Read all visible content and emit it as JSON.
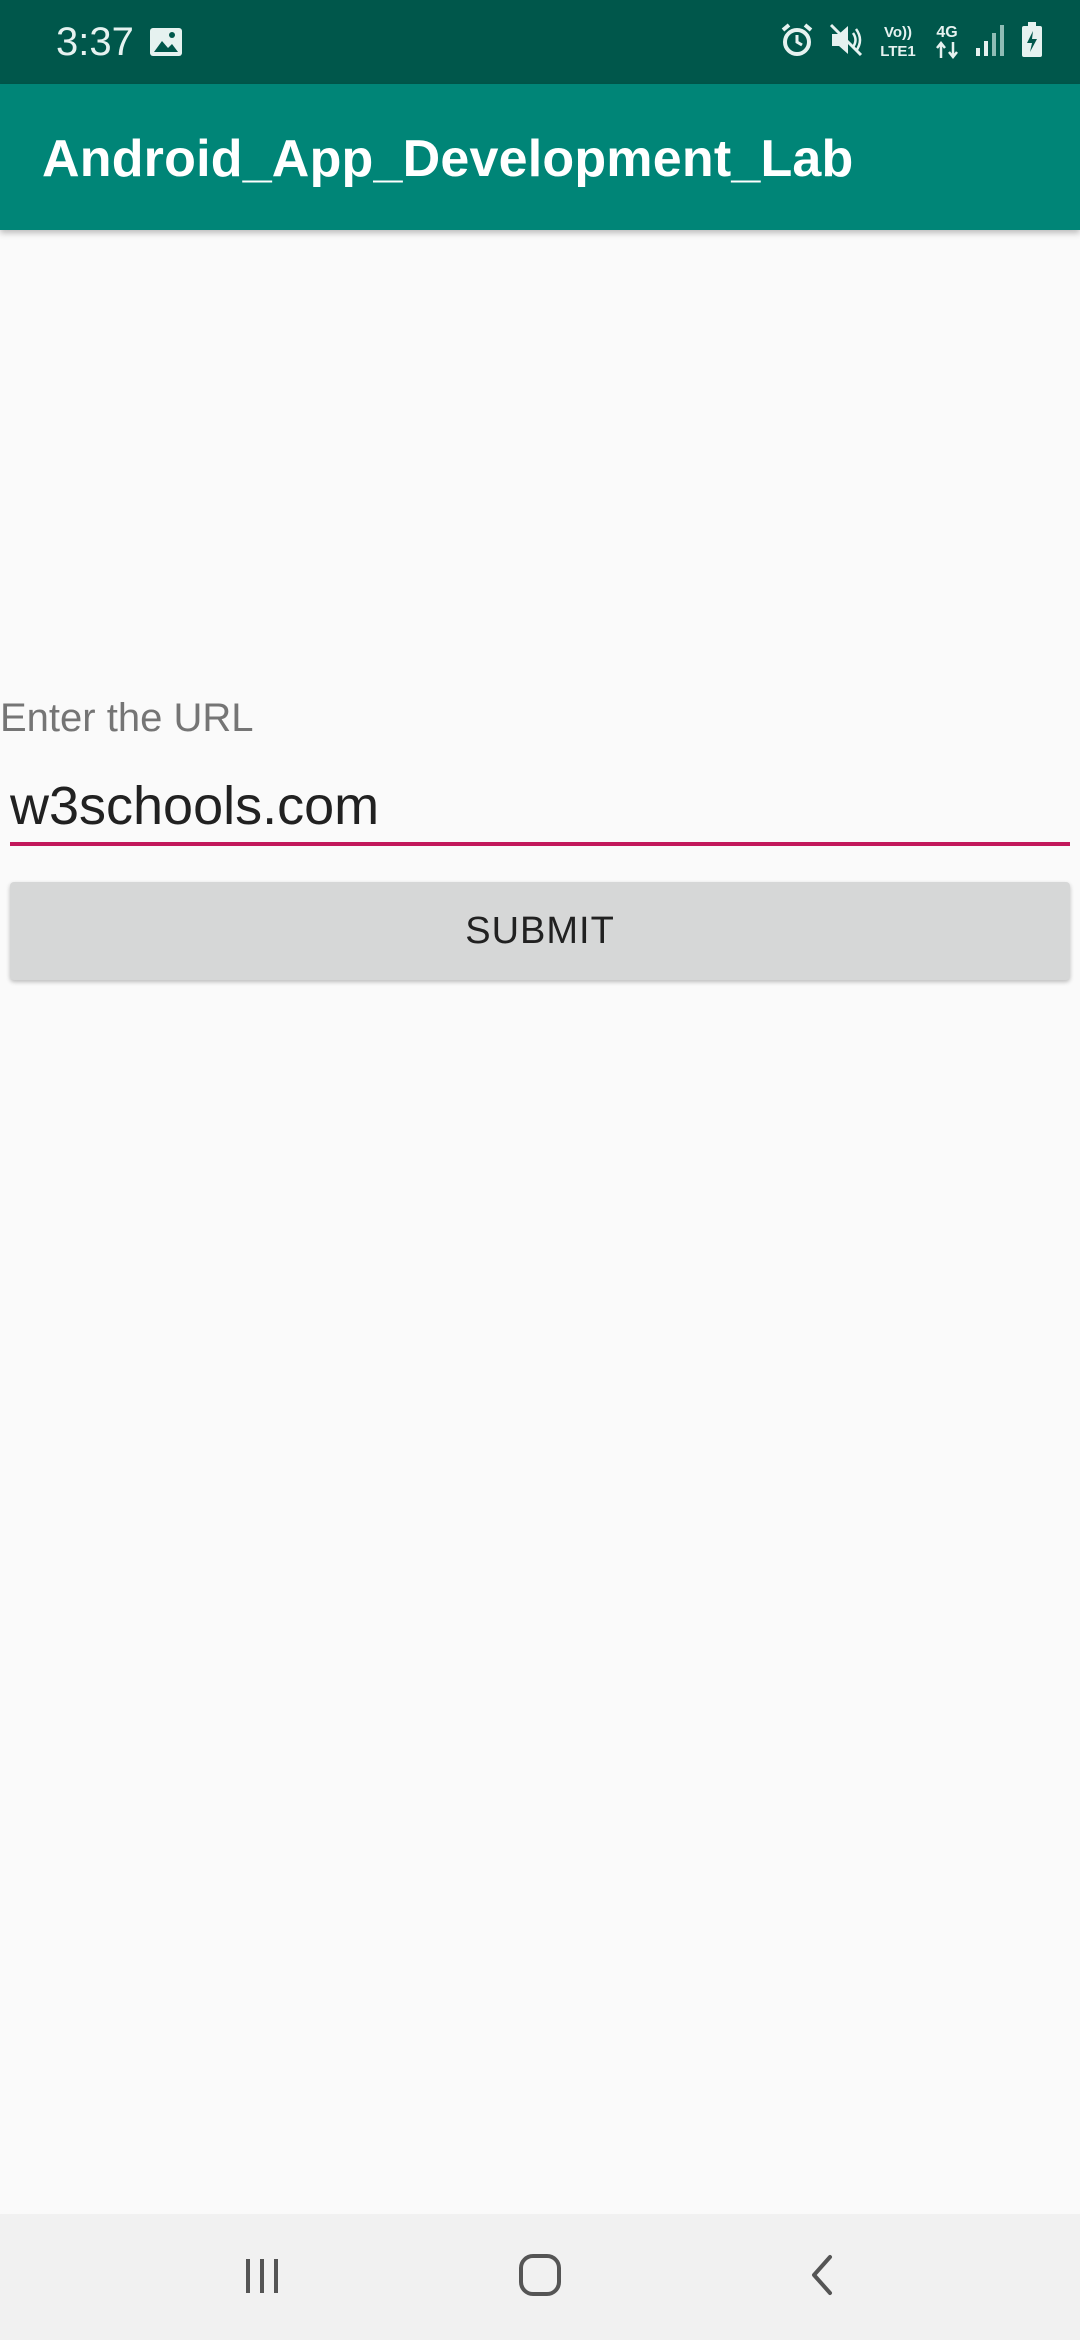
{
  "status_bar": {
    "time": "3:37",
    "left_icons": [
      "image-icon"
    ],
    "right_icons": [
      "alarm-icon",
      "mute-icon",
      "volte-icon",
      "network-4g-icon",
      "signal-icon",
      "battery-charging-icon"
    ],
    "volte_label_top": "Vo))",
    "volte_label_bottom": "LTE1",
    "network_label": "4G"
  },
  "app_bar": {
    "title": "Android_App_Development_Lab"
  },
  "form": {
    "url_label": "Enter the URL",
    "url_value": "w3schools.com",
    "submit_label": "SUBMIT"
  },
  "nav_bar": {
    "buttons": [
      "recent-apps-icon",
      "home-icon",
      "back-icon"
    ]
  },
  "colors": {
    "status_bar": "#00574b",
    "app_bar": "#008577",
    "accent": "#c2185b",
    "button": "#d6d7d7",
    "background": "#fafafa"
  }
}
